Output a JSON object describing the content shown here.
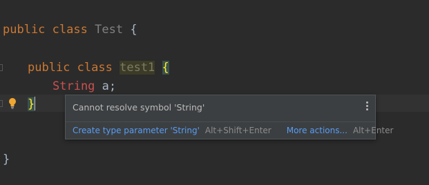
{
  "editor": {
    "line1": {
      "keyword1": "public",
      "keyword2": "class",
      "name": "Test",
      "brace": "{"
    },
    "line2": {
      "keyword1": "public",
      "keyword2": "class",
      "name": "test1",
      "brace": "{"
    },
    "line3": {
      "type": "String",
      "var": "a;"
    },
    "line4": {
      "brace": "}"
    },
    "line5": {
      "brace": "}"
    }
  },
  "popup": {
    "message": "Cannot resolve symbol 'String'",
    "action_label": "Create type parameter 'String'",
    "action_shortcut": "Alt+Shift+Enter",
    "more_label": "More actions...",
    "more_shortcut": "Alt+Enter"
  },
  "icons": {
    "bulb": "lightbulb-icon",
    "menu": "more-options-icon"
  },
  "colors": {
    "background": "#2b2b2b",
    "keyword": "#cc7832",
    "error_type": "#cc5050",
    "link": "#589df6"
  }
}
